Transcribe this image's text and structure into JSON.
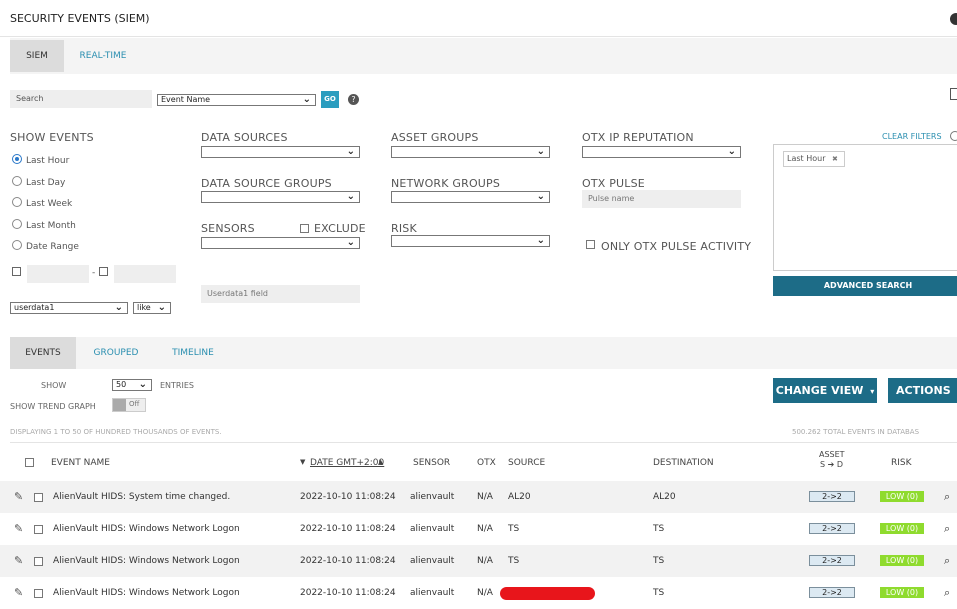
{
  "page": {
    "title": "SECURITY EVENTS (SIEM)"
  },
  "tabs": [
    "SIEM",
    "REAL-TIME"
  ],
  "search": {
    "label": "Search",
    "type": "Event Name",
    "go": "GO"
  },
  "show_events": {
    "label": "SHOW EVENTS",
    "options": [
      "Last Hour",
      "Last Day",
      "Last Week",
      "Last Month",
      "Date Range"
    ],
    "selected": "Last Hour"
  },
  "filters": {
    "data_sources": "DATA SOURCES",
    "asset_groups": "ASSET GROUPS",
    "otx_ip": "OTX IP REPUTATION",
    "data_source_groups": "DATA SOURCE GROUPS",
    "network_groups": "NETWORK GROUPS",
    "otx_pulse": "OTX PULSE",
    "pulse_placeholder": "Pulse name",
    "sensors": "SENSORS",
    "exclude": "EXCLUDE",
    "risk": "RISK",
    "only_otx": "ONLY OTX PULSE ACTIVITY",
    "userdata_field": "Userdata1 field",
    "userdata_select": "userdata1",
    "like_select": "like",
    "date_sep": "-"
  },
  "right_panel": {
    "clear_filters": "CLEAR FILTERS",
    "tag": "Last Hour",
    "tag_close": "✖",
    "advanced_search": "ADVANCED SEARCH"
  },
  "view_tabs": [
    "EVENTS",
    "GROUPED",
    "TIMELINE"
  ],
  "controls": {
    "show": "SHOW",
    "entries_value": "50",
    "entries": "ENTRIES",
    "trend": "SHOW TREND GRAPH",
    "trend_state": "Off",
    "change_view": "CHANGE VIEW",
    "actions": "ACTIONS",
    "caret": "▾"
  },
  "summary": {
    "displaying": "DISPLAYING 1 TO 50 OF HUNDRED THOUSANDS OF EVENTS.",
    "total": "500.262 TOTAL EVENTS IN DATABAS"
  },
  "table": {
    "headers": {
      "event": "EVENT NAME",
      "date": "DATE GMT+2:00",
      "sensor": "SENSOR",
      "otx": "OTX",
      "source": "SOURCE",
      "destination": "DESTINATION",
      "asset_top": "ASSET",
      "asset_bottom": "S ➔ D",
      "risk": "RISK"
    },
    "sort_down": "▼",
    "sort_up": "▲",
    "rows": [
      {
        "event": "AlienVault HIDS: System time changed.",
        "date": "2022-10-10 11:08:24",
        "sensor": "alienvault",
        "otx": "N/A",
        "source": "AL20",
        "destination": "AL20",
        "asset": "2->2",
        "risk": "LOW (0)"
      },
      {
        "event": "AlienVault HIDS: Windows Network Logon",
        "date": "2022-10-10 11:08:24",
        "sensor": "alienvault",
        "otx": "N/A",
        "source": "TS",
        "destination": "TS",
        "asset": "2->2",
        "risk": "LOW (0)"
      },
      {
        "event": "AlienVault HIDS: Windows Network Logon",
        "date": "2022-10-10 11:08:24",
        "sensor": "alienvault",
        "otx": "N/A",
        "source": "TS",
        "destination": "TS",
        "asset": "2->2",
        "risk": "LOW (0)"
      },
      {
        "event": "AlienVault HIDS: Windows Network Logon",
        "date": "2022-10-10 11:08:24",
        "sensor": "alienvault",
        "otx": "N/A",
        "source": "",
        "destination": "TS",
        "asset": "2->2",
        "risk": "LOW (0)"
      }
    ]
  },
  "colors": {
    "accent": "#1d6c87",
    "link": "#2b8fb0",
    "risk_low": "#8fdb2e",
    "redaction": "#e8151b"
  }
}
